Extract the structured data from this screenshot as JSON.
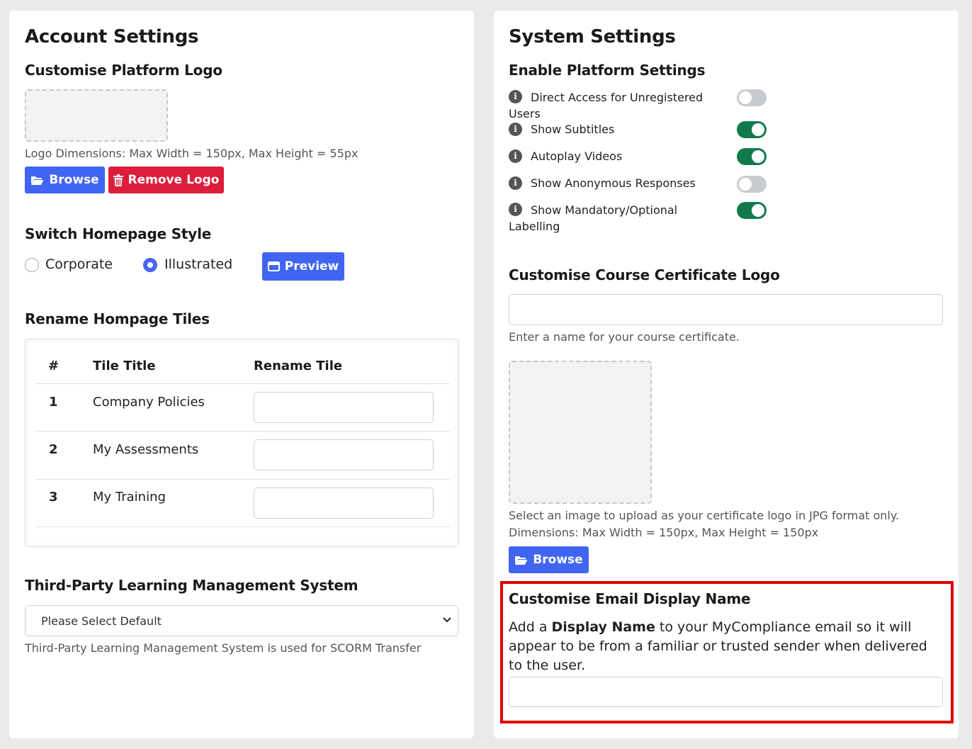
{
  "account": {
    "title": "Account Settings",
    "logo_heading": "Customise Platform Logo",
    "logo_dimensions": "Logo Dimensions: Max Width = 150px, Max Height = 55px",
    "browse_label": "Browse",
    "remove_logo_label": "Remove Logo",
    "homepage_style_heading": "Switch Homepage Style",
    "style_options": [
      {
        "label": "Corporate",
        "checked": false
      },
      {
        "label": "Illustrated",
        "checked": true
      }
    ],
    "preview_label": "Preview",
    "rename_heading": "Rename Hompage Tiles",
    "table": {
      "headers": [
        "#",
        "Tile Title",
        "Rename Tile"
      ],
      "rows": [
        {
          "num": "1",
          "title": "Company Policies",
          "rename": ""
        },
        {
          "num": "2",
          "title": "My Assessments",
          "rename": ""
        },
        {
          "num": "3",
          "title": "My Training",
          "rename": ""
        }
      ]
    },
    "lms_heading": "Third-Party Learning Management System",
    "lms_select_value": "Please Select Default",
    "lms_help": "Third-Party Learning Management System is used for SCORM Transfer"
  },
  "system": {
    "title": "System Settings",
    "enable_heading": "Enable Platform Settings",
    "settings": [
      {
        "line1": "Direct Access for Unregistered",
        "line2": "Users",
        "enabled": false
      },
      {
        "line1": "Show Subtitles",
        "line2": "",
        "enabled": true
      },
      {
        "line1": "Autoplay Videos",
        "line2": "",
        "enabled": true
      },
      {
        "line1": "Show Anonymous Responses",
        "line2": "",
        "enabled": false
      },
      {
        "line1": "Show Mandatory/Optional",
        "line2": "Labelling",
        "enabled": true
      }
    ],
    "cert_heading": "Customise Course Certificate Logo",
    "cert_name_value": "",
    "cert_name_help": "Enter a name for your course certificate.",
    "cert_image_help_1": "Select an image to upload as your certificate logo in JPG format only.",
    "cert_image_help_2": "Dimensions: Max Width = 150px, Max Height = 150px",
    "cert_browse_label": "Browse",
    "email_heading": "Customise Email Display Name",
    "email_desc_prefix": "Add a ",
    "email_desc_bold": "Display Name",
    "email_desc_suffix": " to your MyCompliance email so it will appear to be from a familiar or trusted sender when delivered to the user.",
    "email_display_value": ""
  },
  "colors": {
    "primary": "#4165f3",
    "danger": "#dc1d3c",
    "toggle_on": "#117a4c",
    "highlight": "#e00000"
  }
}
